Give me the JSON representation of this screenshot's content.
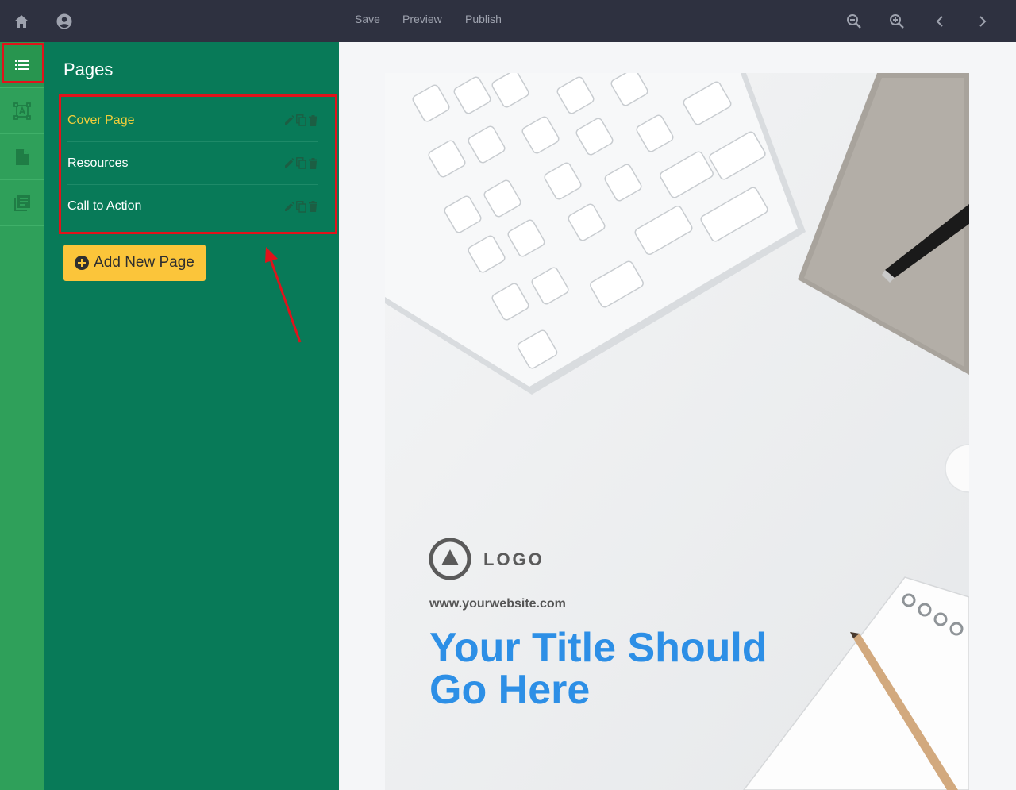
{
  "topbar": {
    "nav": [
      "Save",
      "Preview",
      "Publish"
    ]
  },
  "sidebar": {
    "title": "Pages",
    "pages": [
      {
        "label": "Cover Page",
        "current": true
      },
      {
        "label": "Resources",
        "current": false
      },
      {
        "label": "Call to Action",
        "current": false
      }
    ],
    "add_button": "Add New Page"
  },
  "canvas": {
    "logo_text": "LOGO",
    "website": "www.yourwebsite.com",
    "title": "Your Title Should Go Here"
  },
  "colors": {
    "topbar": "#2e3140",
    "rail": "#2fa05a",
    "panel": "#087a58",
    "current_page": "#f1cd3a",
    "button": "#fbc53a",
    "title": "#2d8fe6",
    "highlight": "#e0131b"
  }
}
